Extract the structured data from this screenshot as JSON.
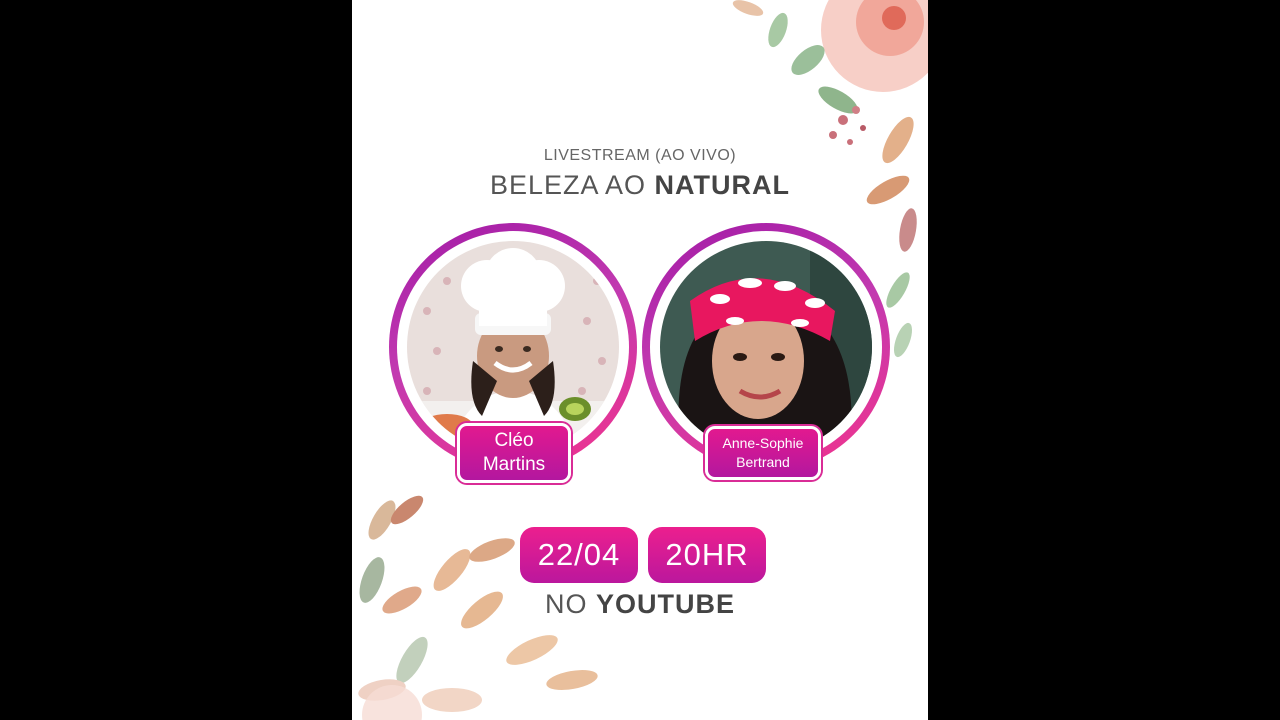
{
  "colors": {
    "background": "#000000",
    "poster": "#ffffff",
    "accent_pink": "#ec1f8e",
    "accent_purple": "#a21aa6",
    "text_gray": "#555555"
  },
  "header": {
    "subtitle": "LIVESTREAM (AO VIVO)",
    "title_prefix": "BELEZA AO",
    "title_emphasis": "NATURAL"
  },
  "guests": [
    {
      "name_line1": "Cléo",
      "name_line2": "Martins",
      "photo": "chef-portrait"
    },
    {
      "name_line1": "Anne-Sophie",
      "name_line2": "Bertrand",
      "photo": "headband-portrait"
    }
  ],
  "event": {
    "date": "22/04",
    "time": "20HR",
    "platform_prefix": "NO",
    "platform_name": "YOUTUBE"
  },
  "decorations": [
    "watercolor-floral-top-right",
    "watercolor-leaves-bottom-left"
  ]
}
